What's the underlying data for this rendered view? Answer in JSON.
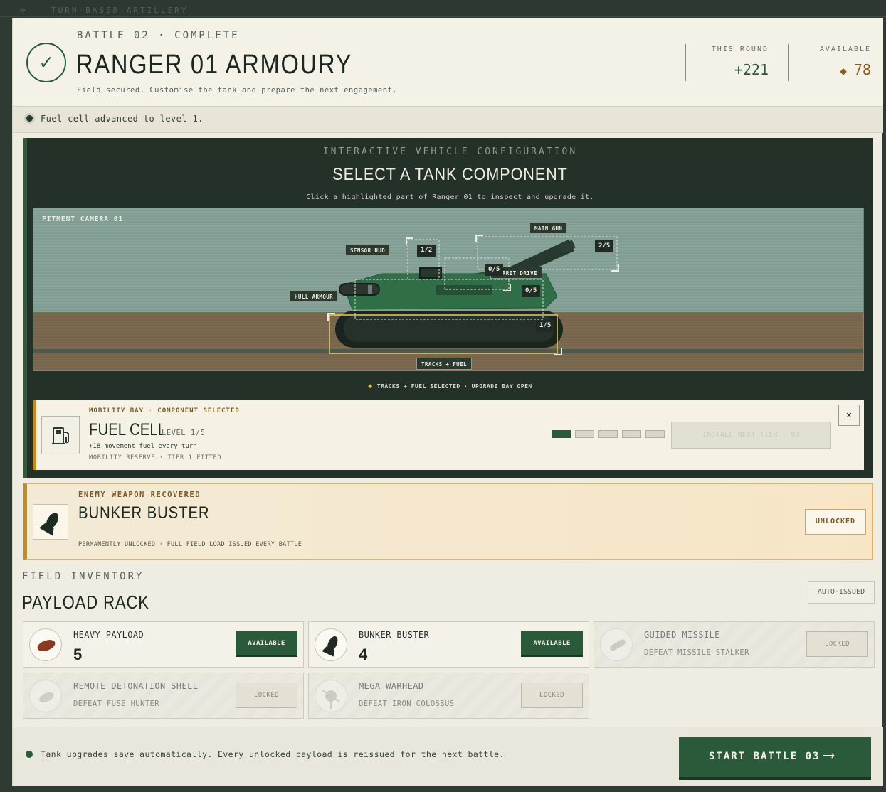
{
  "background": {
    "title": "TURN-BASED ARTILLERY"
  },
  "header": {
    "eyebrow": "BATTLE 02 · COMPLETE",
    "title": "RANGER 01 ARMOURY",
    "subtitle": "Field secured. Customise the tank and prepare the next engagement.",
    "check_icon": "checkmark-icon",
    "stats": [
      {
        "label": "THIS ROUND",
        "value": "+221"
      },
      {
        "label": "AVAILABLE",
        "value": "78",
        "icon": "diamond-icon"
      }
    ]
  },
  "notice": {
    "text": "Fuel cell advanced to level 1."
  },
  "config": {
    "eyebrow": "INTERACTIVE VEHICLE CONFIGURATION",
    "title": "SELECT A TANK COMPONENT",
    "subtitle": "Click a highlighted part of Ranger 01 to inspect and upgrade it.",
    "camera_label": "FITMENT CAMERA 01",
    "parts": [
      {
        "label": "SENSOR HUD",
        "level": "1/2"
      },
      {
        "label": "MAIN GUN",
        "level": "2/5"
      },
      {
        "label": "TURRET DRIVE",
        "level": "0/5"
      },
      {
        "label": "HULL ARMOUR",
        "level": "0/5"
      },
      {
        "label": "TRACKS + FUEL",
        "level": "1/5"
      }
    ],
    "selection_status": "TRACKS + FUEL SELECTED · UPGRADE BAY OPEN",
    "detail": {
      "eyebrow": "MOBILITY BAY · COMPONENT SELECTED",
      "name": "FUEL CELL",
      "level": "LEVEL 1/5",
      "effect": "+18 movement fuel every turn",
      "meta": "MOBILITY RESERVE · TIER 1 FITTED",
      "level_current": 1,
      "level_max": 5,
      "install_label": "INSTALL NEXT TIER · 90",
      "close_label": "✕",
      "icon": "fuel-pump-icon"
    }
  },
  "recovered": {
    "eyebrow": "ENEMY WEAPON RECOVERED",
    "name": "BUNKER BUSTER",
    "meta": "PERMANENTLY UNLOCKED · FULL FIELD LOAD ISSUED EVERY BATTLE",
    "badge": "UNLOCKED",
    "icon": "bunker-buster-icon"
  },
  "inventory": {
    "eyebrow": "FIELD INVENTORY",
    "title": "PAYLOAD RACK",
    "badge": "AUTO-ISSUED",
    "items": [
      {
        "name": "HEAVY PAYLOAD",
        "count": "5",
        "status": "AVAILABLE",
        "locked": false,
        "icon": "heavy-payload-icon"
      },
      {
        "name": "BUNKER BUSTER",
        "count": "4",
        "status": "AVAILABLE",
        "locked": false,
        "icon": "bunker-buster-icon"
      },
      {
        "name": "GUIDED MISSILE",
        "requirement": "DEFEAT MISSILE STALKER",
        "status": "LOCKED",
        "locked": true,
        "icon": "guided-missile-icon"
      },
      {
        "name": "REMOTE DETONATION SHELL",
        "requirement": "DEFEAT FUSE HUNTER",
        "status": "LOCKED",
        "locked": true,
        "icon": "remote-shell-icon"
      },
      {
        "name": "MEGA WARHEAD",
        "requirement": "DEFEAT IRON COLOSSUS",
        "status": "LOCKED",
        "locked": true,
        "icon": "mega-warhead-icon"
      }
    ]
  },
  "footer": {
    "text": "Tank upgrades save automatically. Every unlocked payload is reissued for the next battle.",
    "start_label": "START BATTLE 03",
    "start_arrow": "⟶"
  },
  "colors": {
    "brand_green": "#2b5a3b",
    "accent_gold": "#c48b23",
    "panel_dark": "#233129",
    "cream": "#f4f1e7"
  }
}
